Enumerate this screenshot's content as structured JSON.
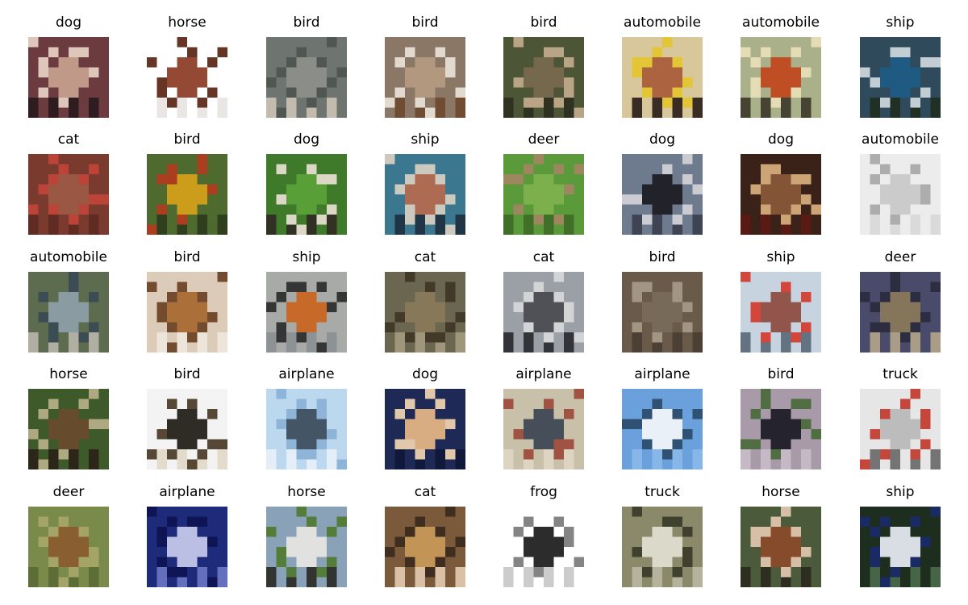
{
  "grid": {
    "columns": 8,
    "items": [
      {
        "label": "dog",
        "colors": [
          "#6b3b3f",
          "#c9a28f",
          "#e8d3c6",
          "#2a1a1e"
        ]
      },
      {
        "label": "horse",
        "colors": [
          "#ffffff",
          "#8a3a22",
          "#5a2414",
          "#e8e4e2"
        ]
      },
      {
        "label": "bird",
        "colors": [
          "#6e7470",
          "#8c8f8a",
          "#4d5550",
          "#c9c1b3"
        ]
      },
      {
        "label": "bird",
        "colors": [
          "#8b7765",
          "#b59b80",
          "#e9e2d8",
          "#6e4a2e"
        ]
      },
      {
        "label": "bird",
        "colors": [
          "#4c5536",
          "#7a6a4e",
          "#c2ad8d",
          "#2d301f"
        ]
      },
      {
        "label": "automobile",
        "colors": [
          "#d8c79b",
          "#a85a38",
          "#e3c62e",
          "#2a1e1b"
        ]
      },
      {
        "label": "automobile",
        "colors": [
          "#a9b08a",
          "#c2451c",
          "#e9dfb8",
          "#3f3a2a"
        ]
      },
      {
        "label": "ship",
        "colors": [
          "#2f4a5a",
          "#1d5b85",
          "#cfd8de",
          "#1f2e20"
        ]
      },
      {
        "label": "cat",
        "colors": [
          "#7a3b2e",
          "#9c5a46",
          "#c04438",
          "#5c2a22"
        ]
      },
      {
        "label": "bird",
        "colors": [
          "#4f6a2e",
          "#d6a21a",
          "#b33b1e",
          "#2c3b1c"
        ]
      },
      {
        "label": "dog",
        "colors": [
          "#3f7a2a",
          "#5aa23a",
          "#e8e0d2",
          "#2f2a22"
        ]
      },
      {
        "label": "ship",
        "colors": [
          "#3b7890",
          "#b86a4e",
          "#d9d0c2",
          "#1e3140"
        ]
      },
      {
        "label": "deer",
        "colors": [
          "#5a9a3a",
          "#7fb24e",
          "#a38562",
          "#3e6b27"
        ]
      },
      {
        "label": "dog",
        "colors": [
          "#6e7a8e",
          "#1a1a22",
          "#d3d3d8",
          "#3a3f4e"
        ]
      },
      {
        "label": "dog",
        "colors": [
          "#3a2218",
          "#8a5a3a",
          "#d9b07f",
          "#5b1a12"
        ]
      },
      {
        "label": "automobile",
        "colors": [
          "#ececec",
          "#c8c8c8",
          "#a7a7a7",
          "#d8d8d8"
        ]
      },
      {
        "label": "automobile",
        "colors": [
          "#5d6b4e",
          "#8ea0a8",
          "#3a4a55",
          "#b9b5a8"
        ]
      },
      {
        "label": "bird",
        "colors": [
          "#dbcbb8",
          "#a7682e",
          "#6a4022",
          "#efe6dc"
        ]
      },
      {
        "label": "ship",
        "colors": [
          "#a8aaa8",
          "#c9641e",
          "#2b2b2b",
          "#8b9092"
        ]
      },
      {
        "label": "cat",
        "colors": [
          "#6b6650",
          "#8a7a5a",
          "#3f3526",
          "#a49a80"
        ]
      },
      {
        "label": "cat",
        "colors": [
          "#9aa0a6",
          "#4a4a50",
          "#d8d8da",
          "#2a2a30"
        ]
      },
      {
        "label": "bird",
        "colors": [
          "#6a5a4a",
          "#7a6b5a",
          "#a89a88",
          "#4a3e32"
        ]
      },
      {
        "label": "ship",
        "colors": [
          "#c7d4e0",
          "#8c4a3e",
          "#d23a2e",
          "#5a6a78"
        ]
      },
      {
        "label": "deer",
        "colors": [
          "#4a4a6a",
          "#8a7a5a",
          "#2a2a3e",
          "#b2a48a"
        ]
      },
      {
        "label": "horse",
        "colors": [
          "#3e5a2a",
          "#6a4a2e",
          "#b8b08a",
          "#2a2218"
        ]
      },
      {
        "label": "bird",
        "colors": [
          "#f3f3f3",
          "#1e1a14",
          "#4a3a26",
          "#e2d9c8"
        ]
      },
      {
        "label": "airplane",
        "colors": [
          "#bcd8ef",
          "#3a4a5a",
          "#8ab2d6",
          "#e6f0f8"
        ]
      },
      {
        "label": "dog",
        "colors": [
          "#1e2a55",
          "#e8b886",
          "#f2d6b3",
          "#0f1838"
        ]
      },
      {
        "label": "airplane",
        "colors": [
          "#c8c0a8",
          "#3a4452",
          "#9c4a3a",
          "#ded6c4"
        ]
      },
      {
        "label": "airplane",
        "colors": [
          "#6aa0dc",
          "#f4f6f8",
          "#2a4a6a",
          "#8ab8e8"
        ]
      },
      {
        "label": "bird",
        "colors": [
          "#a89aa8",
          "#1a1a24",
          "#4a6a3a",
          "#c8bcc8"
        ]
      },
      {
        "label": "truck",
        "colors": [
          "#e6e6e6",
          "#b8b8b8",
          "#c23a2e",
          "#6a6a6a"
        ]
      },
      {
        "label": "deer",
        "colors": [
          "#7a8a4a",
          "#8a5a2e",
          "#a6a668",
          "#5a6a34"
        ]
      },
      {
        "label": "airplane",
        "colors": [
          "#1e2a7a",
          "#c8ccec",
          "#0e1450",
          "#6a76c2"
        ]
      },
      {
        "label": "horse",
        "colors": [
          "#8aa2b8",
          "#e8e6e2",
          "#4e7a2e",
          "#2a2a26"
        ]
      },
      {
        "label": "cat",
        "colors": [
          "#7a5a3a",
          "#c89a5a",
          "#3a2a1e",
          "#e2cab0"
        ]
      },
      {
        "label": "frog",
        "colors": [
          "#ffffff",
          "#1a1a1a",
          "#7a7a7a",
          "#c8c8c8"
        ]
      },
      {
        "label": "truck",
        "colors": [
          "#8a8a6a",
          "#e2e0d2",
          "#3a3a2a",
          "#b8b6a0"
        ]
      },
      {
        "label": "horse",
        "colors": [
          "#4a5a3a",
          "#8a4a2a",
          "#e2c8b0",
          "#2a2a1e"
        ]
      },
      {
        "label": "ship",
        "colors": [
          "#1e2e1e",
          "#e8eef4",
          "#1a2a6a",
          "#4a6a4a"
        ]
      }
    ]
  }
}
